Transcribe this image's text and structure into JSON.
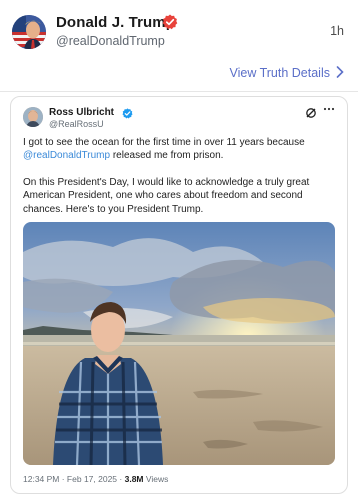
{
  "post": {
    "author_name": "Donald J. Trump",
    "author_handle": "@realDonaldTrump",
    "time_ago": "1h",
    "view_details_label": "View Truth Details"
  },
  "embed": {
    "author_name": "Ross Ulbricht",
    "author_handle": "@RealRossU",
    "text_line1_a": "I got to see the ocean for the first time in over 11 years because",
    "mention": "@realDonaldTrump",
    "text_line2_b": "released me from prison.",
    "paragraph2": "On this President's Day, I would like to acknowledge a truly great American President, one who cares about freedom and second chances. Here's to you President Trump.",
    "meta_date": "12:34 PM · Feb 17, 2025 ·",
    "views_count": "3.8M",
    "views_label": "Views"
  },
  "icons": {
    "verified_main": "verified-badge-icon",
    "verified_embed": "verified-check-icon",
    "platform_logo": "x-logo-icon",
    "more": "more-options-icon",
    "chevron": "chevron-right-icon"
  },
  "colors": {
    "link": "#5b6fc8",
    "mention": "#3b8ad8",
    "verified_main": "#e8423b",
    "verified_embed": "#1d9bf0"
  }
}
